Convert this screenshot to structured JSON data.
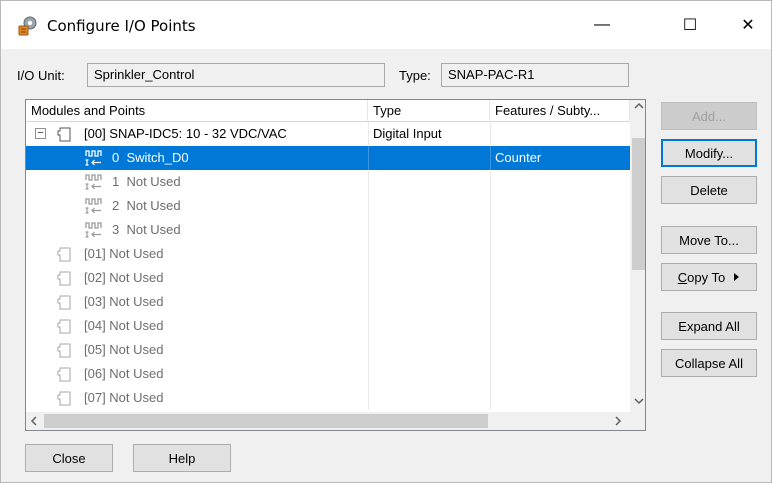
{
  "window": {
    "title": "Configure I/O Points",
    "minimize_glyph": "—",
    "maximize_glyph": "☐",
    "close_glyph": "✕"
  },
  "io_unit": {
    "label": "I/O Unit:",
    "value": "Sprinkler_Control"
  },
  "type_field": {
    "label": "Type:",
    "value": "SNAP-PAC-R1"
  },
  "table": {
    "columns": [
      "Modules and Points",
      "Type",
      "Features / Subty..."
    ],
    "rows": [
      {
        "expander": "−",
        "icon": "module-icon",
        "label": "[00] SNAP-IDC5: 10 - 32 VDC/VAC",
        "type": "Digital Input",
        "feature": "",
        "level": 0,
        "muted": false,
        "selected": false
      },
      {
        "expander": "",
        "icon": "digital-input-point-icon",
        "label": "0  Switch_D0",
        "type": "",
        "feature": "Counter",
        "level": 1,
        "muted": false,
        "selected": true
      },
      {
        "expander": "",
        "icon": "digital-input-point-icon",
        "label": "1  Not Used",
        "type": "",
        "feature": "",
        "level": 1,
        "muted": true,
        "selected": false
      },
      {
        "expander": "",
        "icon": "digital-input-point-icon",
        "label": "2  Not Used",
        "type": "",
        "feature": "",
        "level": 1,
        "muted": true,
        "selected": false
      },
      {
        "expander": "",
        "icon": "digital-input-point-icon",
        "label": "3  Not Used",
        "type": "",
        "feature": "",
        "level": 1,
        "muted": true,
        "selected": false
      },
      {
        "expander": "",
        "icon": "module-icon",
        "label": "[01] Not Used",
        "type": "",
        "feature": "",
        "level": 0,
        "muted": true,
        "selected": false
      },
      {
        "expander": "",
        "icon": "module-icon",
        "label": "[02] Not Used",
        "type": "",
        "feature": "",
        "level": 0,
        "muted": true,
        "selected": false
      },
      {
        "expander": "",
        "icon": "module-icon",
        "label": "[03] Not Used",
        "type": "",
        "feature": "",
        "level": 0,
        "muted": true,
        "selected": false
      },
      {
        "expander": "",
        "icon": "module-icon",
        "label": "[04] Not Used",
        "type": "",
        "feature": "",
        "level": 0,
        "muted": true,
        "selected": false
      },
      {
        "expander": "",
        "icon": "module-icon",
        "label": "[05] Not Used",
        "type": "",
        "feature": "",
        "level": 0,
        "muted": true,
        "selected": false
      },
      {
        "expander": "",
        "icon": "module-icon",
        "label": "[06] Not Used",
        "type": "",
        "feature": "",
        "level": 0,
        "muted": true,
        "selected": false
      },
      {
        "expander": "",
        "icon": "module-icon",
        "label": "[07] Not Used",
        "type": "",
        "feature": "",
        "level": 0,
        "muted": true,
        "selected": false
      }
    ]
  },
  "buttons": {
    "add": "Add...",
    "modify": "Modify...",
    "delete": "Delete",
    "move_to": "Move To...",
    "copy_to": "Copy To",
    "expand_all": "Expand All",
    "collapse_all": "Collapse All",
    "close": "Close",
    "help": "Help"
  },
  "colors": {
    "selection": "#0078d7",
    "muted_text": "#6d6d6d"
  }
}
